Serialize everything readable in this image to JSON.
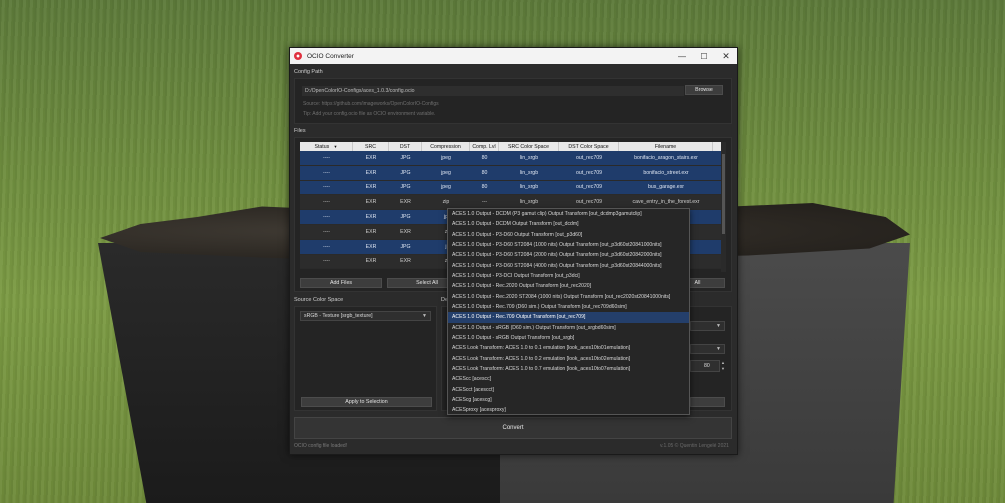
{
  "window": {
    "title": "OCIO Converter",
    "minimize": "—",
    "maximize": "☐",
    "close": "✕"
  },
  "config": {
    "section_label": "Config Path",
    "path": "D:/OpenColorIO-Configs/aces_1.0.3/config.ocio",
    "browse_label": "Browse",
    "source_hint": "Source: https://github.com/imageworks/OpenColorIO-Configs",
    "tip_hint": "Tip: Add your config.ocio file as OCIO environment variable."
  },
  "files": {
    "section_label": "Files",
    "columns": [
      "Status",
      "SRC",
      "DST",
      "Compression",
      "Comp. Lvl",
      "SRC Color Space",
      "DST Color Space",
      "Filename"
    ],
    "sort_indicator": "▼",
    "rows": [
      {
        "selected": true,
        "cells": [
          "----",
          "EXR",
          "JPG",
          "jpeg",
          "80",
          "lin_srgb",
          "out_rec709",
          "bonifacio_aragon_stairs.exr"
        ]
      },
      {
        "selected": true,
        "cells": [
          "----",
          "EXR",
          "JPG",
          "jpeg",
          "80",
          "lin_srgb",
          "out_rec709",
          "bonifacio_street.exr"
        ]
      },
      {
        "selected": true,
        "cells": [
          "----",
          "EXR",
          "JPG",
          "jpeg",
          "80",
          "lin_srgb",
          "out_rec709",
          "bus_garage.exr"
        ]
      },
      {
        "selected": false,
        "cells": [
          "----",
          "EXR",
          "EXR",
          "zip",
          "---",
          "lin_srgb",
          "out_rec709",
          "cave_entry_in_the_forest.exr"
        ]
      },
      {
        "selected": true,
        "cells": [
          "----",
          "EXR",
          "JPG",
          "jp",
          "",
          "",
          "",
          "exr"
        ]
      },
      {
        "selected": false,
        "cells": [
          "----",
          "EXR",
          "EXR",
          "z",
          "",
          "",
          "",
          ""
        ]
      },
      {
        "selected": true,
        "cells": [
          "----",
          "EXR",
          "JPG",
          "j",
          "",
          "",
          "",
          "dings.exr"
        ]
      },
      {
        "selected": false,
        "cells": [
          "----",
          "EXR",
          "EXR",
          "z",
          "",
          "",
          "",
          "r"
        ]
      }
    ],
    "add_files_label": "Add Files",
    "select_all_label": "Select All",
    "right_button_label": "All"
  },
  "source_color_space": {
    "section_label": "Source Color Space",
    "value": "sRGB - Texture [srgb_texture]",
    "apply_label": "Apply to Selection"
  },
  "destination_partial_label": "De",
  "compression_level": "80",
  "dropdown_items": [
    "ACES 1.0 Output - DCDM (P3 gamut clip) Output Transform [out_dcdmp3gamutclip]",
    "ACES 1.0 Output - DCDM Output Transform [out_dcdm]",
    "ACES 1.0 Output - P3-D60 Output Transform [out_p3d60]",
    "ACES 1.0 Output - P3-D60 ST2084 (1000 nits) Output Transform [out_p3d60st20841000nits]",
    "ACES 1.0 Output - P3-D60 ST2084 (2000 nits) Output Transform [out_p3d60st20842000nits]",
    "ACES 1.0 Output - P3-D60 ST2084 (4000 nits) Output Transform [out_p3d60st20844000nits]",
    "ACES 1.0 Output - P3-DCI Output Transform [out_p3dci]",
    "ACES 1.0 Output - Rec.2020 Output Transform [out_rec2020]",
    "ACES 1.0 Output - Rec.2020 ST2084 (1000 nits) Output Transform [out_rec2020st20841000nits]",
    "ACES 1.0 Output - Rec.709 (D60 sim.) Output Transform [out_rec709d60sim]",
    "ACES 1.0 Output - Rec.709 Output Transform [out_rec709]",
    "ACES 1.0 Output - sRGB (D60 sim.) Output Transform [out_srgbd60sim]",
    "ACES 1.0 Output - sRGB Output Transform [out_srgb]",
    "ACES Look Transform: ACES 1.0 to 0.1 emulation [look_aces10to01emulation]",
    "ACES Look Transform: ACES 1.0 to 0.2 emulation [look_aces10to02emulation]",
    "ACES Look Transform: ACES 1.0 to 0.7 emulation [look_aces10to07emulation]",
    "ACEScc [acescc]",
    "ACEScct [acescct]",
    "ACEScg [acescg]",
    "ACESproxy [acesproxy]"
  ],
  "dropdown_highlight_index": 10,
  "convert_label": "Convert",
  "status_left": "OCIO config file loaded!",
  "status_right": "v.1.05 © Quentin Lengelé 2021",
  "colors": {
    "selection": "#1f3c6b",
    "highlight": "#243f6b",
    "window_bg": "#2b2b2b"
  }
}
